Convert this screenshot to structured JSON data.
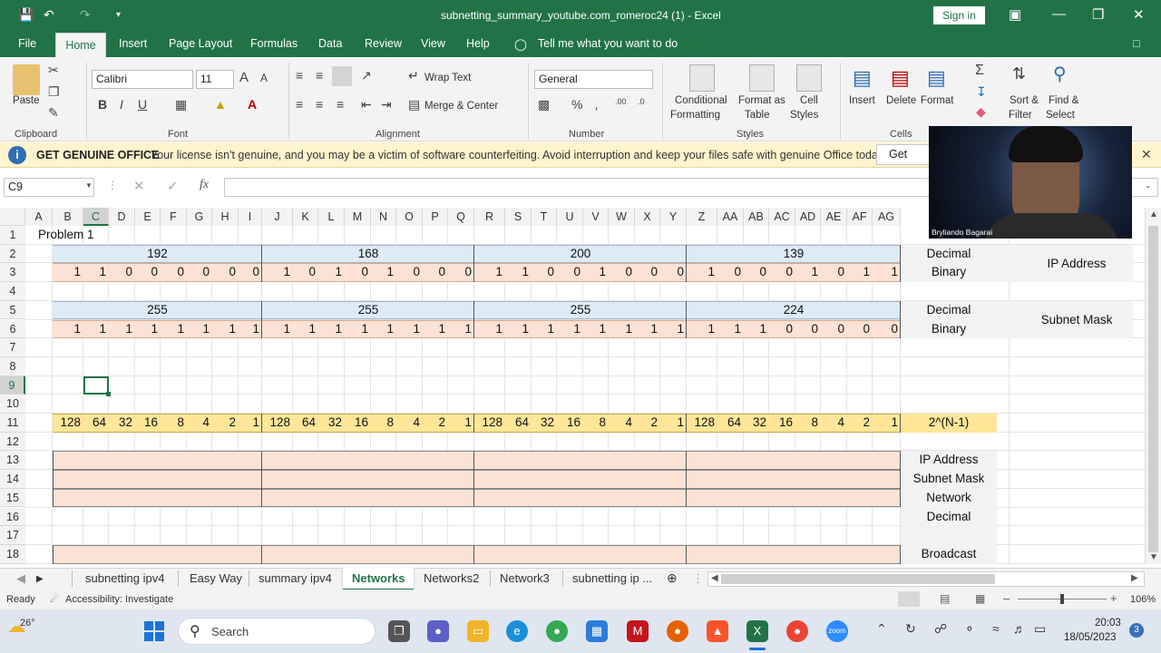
{
  "titlebar": {
    "title": "subnetting_summary_youtube.com_romeroc24 (1)  -  Excel",
    "signin": "Sign in"
  },
  "menus": [
    "File",
    "Home",
    "Insert",
    "Page Layout",
    "Formulas",
    "Data",
    "Review",
    "View",
    "Help"
  ],
  "tellme": "Tell me what you want to do",
  "ribbon": {
    "paste": "Paste",
    "clipboard": "Clipboard",
    "font_name": "Calibri",
    "font_size": "11",
    "font": "Font",
    "wrap": "Wrap Text",
    "merge": "Merge & Center",
    "alignment": "Alignment",
    "numfmt": "General",
    "number": "Number",
    "cond": "Conditional",
    "cond2": "Formatting",
    "fmt_table": "Format as",
    "fmt_table2": "Table",
    "cell_styles": "Cell",
    "cell_styles2": "Styles",
    "styles": "Styles",
    "insert": "Insert",
    "delete": "Delete",
    "format": "Format",
    "cells": "Cells",
    "sort": "Sort &",
    "sort2": "Filter",
    "find": "Find &",
    "find2": "Select"
  },
  "infobar": {
    "title": "GET GENUINE OFFICE",
    "msg": "Your license isn't genuine, and you may be a victim of software counterfeiting. Avoid interruption and keep your files safe with genuine Office today.",
    "btn": "Get genu"
  },
  "namebox": "C9",
  "webcam": {
    "name": "Bryliando Bagarai"
  },
  "columns": [
    "A",
    "B",
    "C",
    "D",
    "E",
    "F",
    "G",
    "H",
    "I",
    "J",
    "K",
    "L",
    "M",
    "N",
    "O",
    "P",
    "Q",
    "R",
    "S",
    "T",
    "U",
    "V",
    "W",
    "X",
    "Y",
    "Z",
    "AA",
    "AB",
    "AC",
    "AD",
    "AE",
    "AF",
    "AG"
  ],
  "rows": [
    "1",
    "2",
    "3",
    "4",
    "5",
    "6",
    "7",
    "8",
    "9",
    "10",
    "11",
    "12",
    "13",
    "14",
    "15",
    "16",
    "17",
    "18"
  ],
  "sheet": {
    "problem": "Problem 1",
    "ip_octets": [
      "192",
      "168",
      "200",
      "139"
    ],
    "ip_bits": [
      "1",
      "1",
      "0",
      "0",
      "0",
      "0",
      "0",
      "0",
      "1",
      "0",
      "1",
      "0",
      "1",
      "0",
      "0",
      "0",
      "1",
      "1",
      "0",
      "0",
      "1",
      "0",
      "0",
      "0",
      "1",
      "0",
      "0",
      "0",
      "1",
      "0",
      "1",
      "1"
    ],
    "mask_octets": [
      "255",
      "255",
      "255",
      "224"
    ],
    "mask_bits": [
      "1",
      "1",
      "1",
      "1",
      "1",
      "1",
      "1",
      "1",
      "1",
      "1",
      "1",
      "1",
      "1",
      "1",
      "1",
      "1",
      "1",
      "1",
      "1",
      "1",
      "1",
      "1",
      "1",
      "1",
      "1",
      "1",
      "1",
      "0",
      "0",
      "0",
      "0",
      "0"
    ],
    "weights": [
      "128",
      "64",
      "32",
      "16",
      "8",
      "4",
      "2",
      "1",
      "128",
      "64",
      "32",
      "16",
      "8",
      "4",
      "2",
      "1",
      "128",
      "64",
      "32",
      "16",
      "8",
      "4",
      "2",
      "1",
      "128",
      "64",
      "32",
      "16",
      "8",
      "4",
      "2",
      "1"
    ],
    "labels": {
      "decimal": "Decimal",
      "binary": "Binary",
      "ip_address": "IP Address",
      "decimal2": "Decimal",
      "binary2": "Binary",
      "subnet_mask": "Subnet Mask",
      "formula": "2^(N-1)",
      "ip2": "IP Address",
      "mask2": "Subnet Mask",
      "network": "Network",
      "decimal3": "Decimal",
      "broadcast": "Broadcast"
    }
  },
  "sheets": [
    "subnetting ipv4",
    "Easy Way",
    "summary ipv4",
    "Networks",
    "Networks2",
    "Network3",
    "subnetting ip ..."
  ],
  "active_sheet": "Networks",
  "status": {
    "ready": "Ready",
    "access": "Accessibility: Investigate",
    "zoom": "106%"
  },
  "taskbar": {
    "temp": "26°",
    "search": "Search",
    "time": "20:03",
    "date": "18/05/2023",
    "badge": "3"
  },
  "colors": {
    "excel_green": "#217346",
    "blue_band": "#ddebf7",
    "peach_band": "#fbe2d5",
    "yellow_band": "#ffe699"
  }
}
